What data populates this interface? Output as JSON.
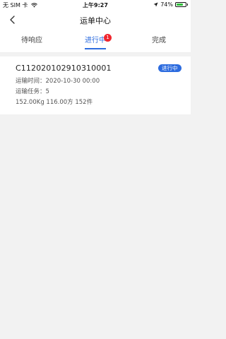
{
  "status_bar": {
    "carrier": "无 SIM 卡",
    "time": "上午9:27",
    "battery_text": "74%",
    "battery_level": 0.74
  },
  "nav": {
    "title": "运单中心"
  },
  "tabs": [
    {
      "label": "待响应",
      "active": false
    },
    {
      "label": "进行中",
      "active": true,
      "badge": "1"
    },
    {
      "label": "完成",
      "active": false
    }
  ],
  "orders": [
    {
      "id": "C112020102910310001",
      "status": "进行中",
      "time_line": "运输时间：2020-10-30 00:00",
      "task_line": "运输任务：5",
      "summary_line": "152.00Kg 116.00方 152件"
    }
  ],
  "colors": {
    "accent": "#2d6cdf",
    "badge": "#f0262e",
    "battery": "#2fbf3a"
  }
}
